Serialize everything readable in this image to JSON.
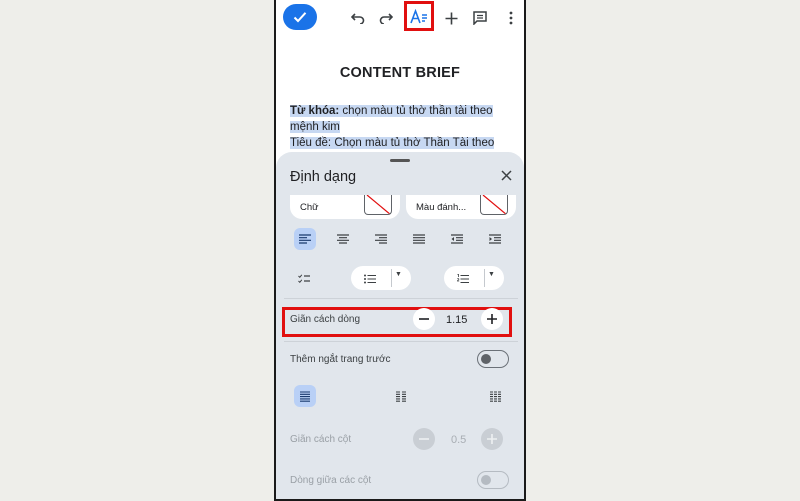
{
  "toolbar": {
    "icons": [
      "check-icon",
      "undo-icon",
      "redo-icon",
      "text-format-icon",
      "add-icon",
      "comment-icon",
      "more-vert-icon"
    ]
  },
  "document": {
    "title": "CONTENT BRIEF",
    "line1_bold": "Từ khóa:",
    "line1_text": " chọn màu tủ thờ thần tài theo",
    "line2_text": "mệnh kim",
    "line3_text": "Tiêu đề: Chọn màu tủ thờ Thần Tài theo"
  },
  "format_panel": {
    "title": "Định dạng",
    "text_color_label": "Chữ",
    "highlight_color_label": "Màu đánh...",
    "line_spacing": {
      "label": "Giãn cách dòng",
      "value": "1.15"
    },
    "page_break": {
      "label": "Thêm ngắt trang trước",
      "on": false
    },
    "column_spacing": {
      "label": "Giãn cách cột",
      "value": "0.5"
    },
    "column_line": {
      "label": "Dòng giữa các cột",
      "on": false
    }
  },
  "colors": {
    "accent": "#1a73e8",
    "highlight_box": "#e10f0f",
    "selection": "#c7d8f2",
    "sheet_bg": "#e1e6ec"
  }
}
